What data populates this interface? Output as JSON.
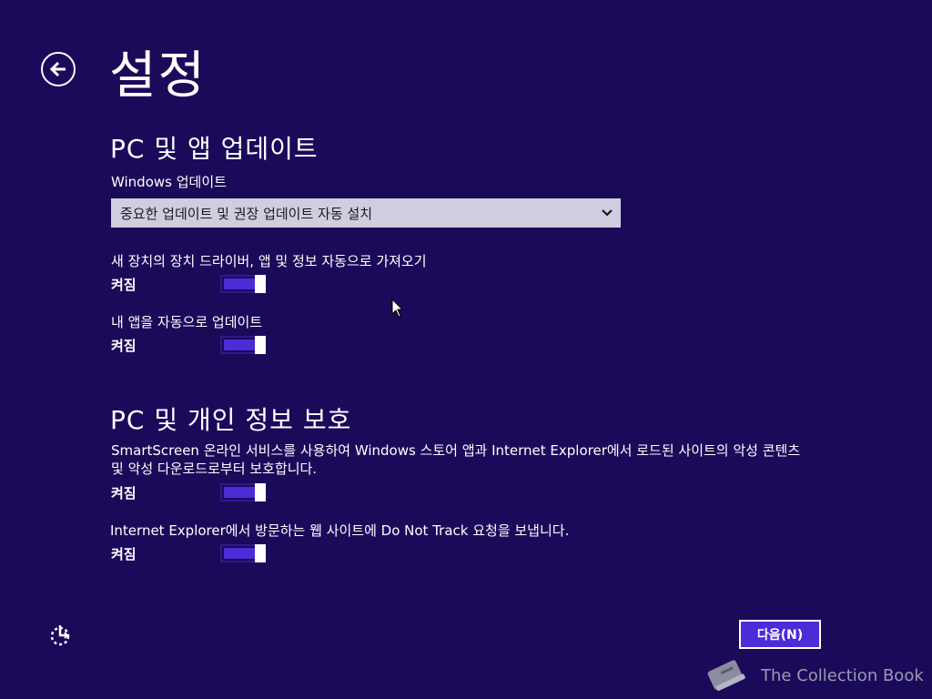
{
  "header": {
    "title": "설정",
    "back_icon": "arrow-left-circle-icon"
  },
  "section_updates": {
    "heading": "PC 및 앱 업데이트",
    "windows_update_label": "Windows 업데이트",
    "windows_update_value": "중요한 업데이트 및 권장 업데이트 자동 설치",
    "device_drivers_label": "새 장치의 장치 드라이버, 앱 및 정보 자동으로 가져오기",
    "device_drivers_state": "켜짐",
    "device_drivers_on": true,
    "app_updates_label": "내 앱을 자동으로 업데이트",
    "app_updates_state": "켜짐",
    "app_updates_on": true
  },
  "section_privacy": {
    "heading": "PC 및 개인 정보 보호",
    "smartscreen_label_line1": "SmartScreen 온라인 서비스를 사용하여 Windows 스토어 앱과 Internet Explorer에서 로드된 사이트의 악성 콘텐츠",
    "smartscreen_label_line2": "및 악성 다운로드로부터 보호합니다.",
    "smartscreen_state": "켜짐",
    "smartscreen_on": true,
    "dnt_label": "Internet Explorer에서 방문하는 웹 사이트에 Do Not Track 요청을 보냅니다.",
    "dnt_state": "켜짐",
    "dnt_on": true
  },
  "footer": {
    "next_label": "다음(N)",
    "ease_of_access_icon": "ease-of-access-icon"
  },
  "watermark": {
    "text": "The Collection Book",
    "icon": "book-icon"
  },
  "colors": {
    "background": "#1b0a5a",
    "accent": "#4b2cd6",
    "dropdown_bg": "#d0cde0"
  }
}
